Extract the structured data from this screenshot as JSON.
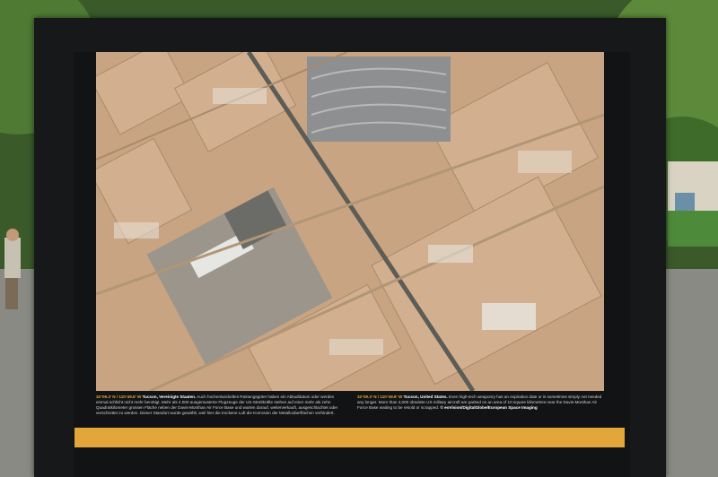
{
  "caption_de": {
    "coords": "32°09.3' N / 110°49.8' W",
    "place": "Tucson, Vereinigte Staaten.",
    "text": "Auch hochentwickeltes Rüstungsgüter haben ein Ablaufdatum oder werden einmal schlicht nicht mehr benötigt. Mehr als 4.000 ausgemusterte Flugzeuge der US-Streitkräfte stehen auf einer mehr als zehn Quadratkilometer grossen Fläche neben der Davis-Monthan Air Force Base und warten darauf, weiterverkauft, ausgeschlachtet oder verschrottet zu werden. Dieser Standort wurde gewählt, weil hier die trockene Luft die Korrosion der Metallooberflächen verhindert."
  },
  "caption_en": {
    "coords": "32°09.3' N / 110°49.8' W",
    "place": "Tucson, United States.",
    "text": "Even high-tech weaponry has an expiration date or is sometimes simply not needed any longer. More than 4,000 obsolete US military aircraft are parked on an area of 10 square kilometres near the Davis-Monthan Air Force Base waiting to be resold or scrapped.",
    "credit": "© eoVision/DigitalGlobe/European Space Imaging"
  },
  "colors": {
    "board": "#16181a",
    "accent_bar": "#e3a63b",
    "desert": "#c7a27f"
  }
}
